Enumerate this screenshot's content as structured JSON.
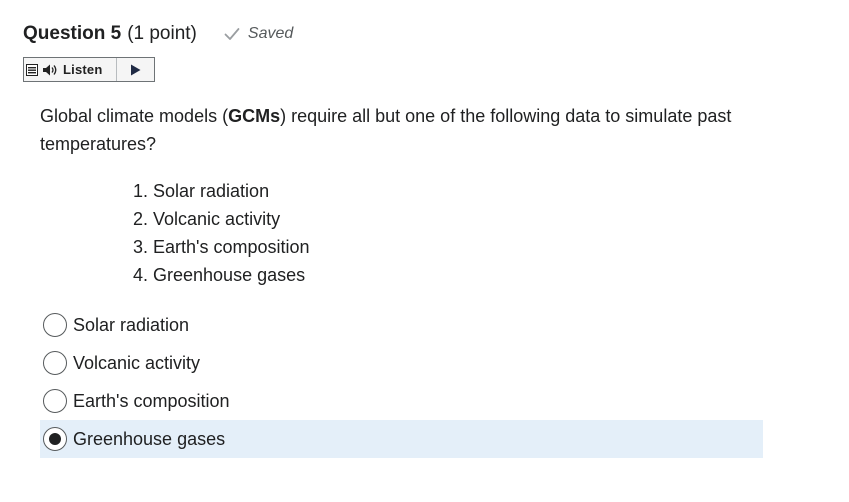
{
  "question": {
    "title": "Question 5",
    "points": "(1 point)",
    "status": "Saved"
  },
  "listen": {
    "label": "Listen"
  },
  "prompt": {
    "before": "Global climate models (",
    "bold": "GCMs",
    "after": ") require all but one of the following data to simulate past temperatures?"
  },
  "list_items": [
    "1. Solar radiation",
    "2. Volcanic activity",
    "3. Earth's composition",
    "4. Greenhouse gases"
  ],
  "options": [
    {
      "label": "Solar radiation",
      "selected": false
    },
    {
      "label": "Volcanic activity",
      "selected": false
    },
    {
      "label": "Earth's composition",
      "selected": false
    },
    {
      "label": "Greenhouse gases",
      "selected": true
    }
  ],
  "colors": {
    "selected_bg": "#e4eff9",
    "text": "#202122",
    "muted": "#565a5c"
  }
}
